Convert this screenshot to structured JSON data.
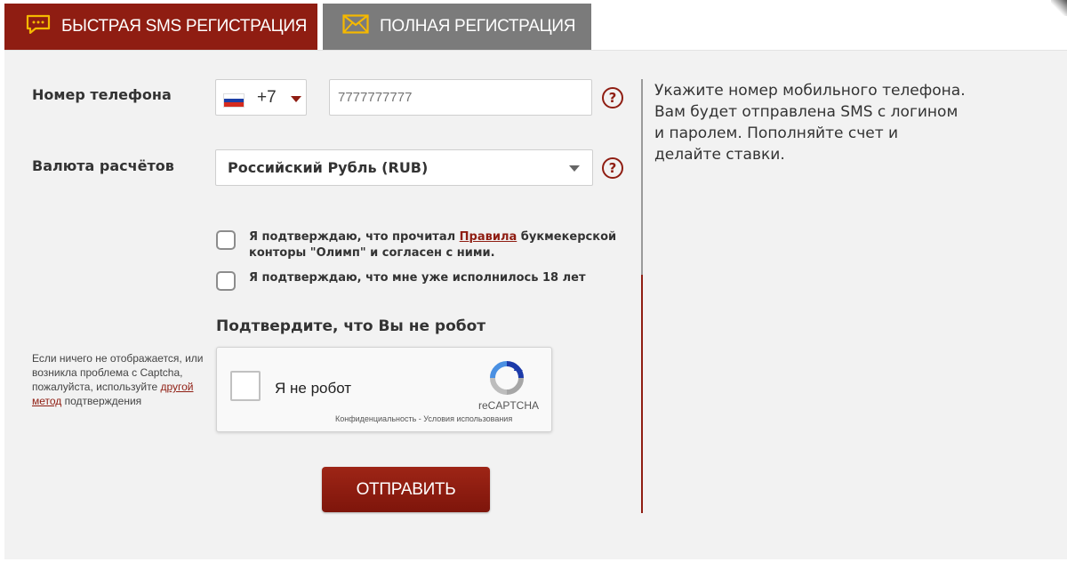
{
  "tabs": {
    "sms": {
      "label": "БЫСТРАЯ SMS РЕГИСТРАЦИЯ",
      "icon": "chat-icon"
    },
    "full": {
      "label": "ПОЛНАЯ РЕГИСТРАЦИЯ",
      "icon": "envelope-icon"
    }
  },
  "form": {
    "phone": {
      "label": "Номер телефона",
      "country_code": "+7",
      "placeholder": "7777777777"
    },
    "currency": {
      "label": "Валюта расчётов",
      "selected": "Российский Рубль (RUB)"
    },
    "help_symbol": "?",
    "rules_checkbox": {
      "text_before": "Я подтверждаю, что прочитал ",
      "link": "Правила",
      "text_after": " букмекерской конторы \"Олимп\" и согласен с ними."
    },
    "age_checkbox": {
      "text": "Я подтверждаю, что мне уже исполнилось 18 лет"
    },
    "captcha_title": "Подтвердите, что Вы не робот",
    "captcha_note": {
      "text_before": "Если ничего не отображается, или возникла проблема с Captcha, пожалуйста, используйте ",
      "link": "другой метод",
      "text_after": " подтверждения"
    },
    "submit_label": "ОТПРАВИТЬ"
  },
  "recaptcha": {
    "checkbox_label": "Я не робот",
    "brand": "reCAPTCHA",
    "privacy": "Конфиденциальность",
    "separator": " - ",
    "terms": "Условия использования"
  },
  "info_text": "Укажите номер мобильного телефона. Вам будет отправлена SMS с логином и паролем. Пополняйте счет и делайте ставки.",
  "colors": {
    "brand": "#8f1d12",
    "tab_inactive": "#7b7b7b",
    "tab_icon": "#f5b800",
    "panel_bg": "#f2f2f2"
  }
}
